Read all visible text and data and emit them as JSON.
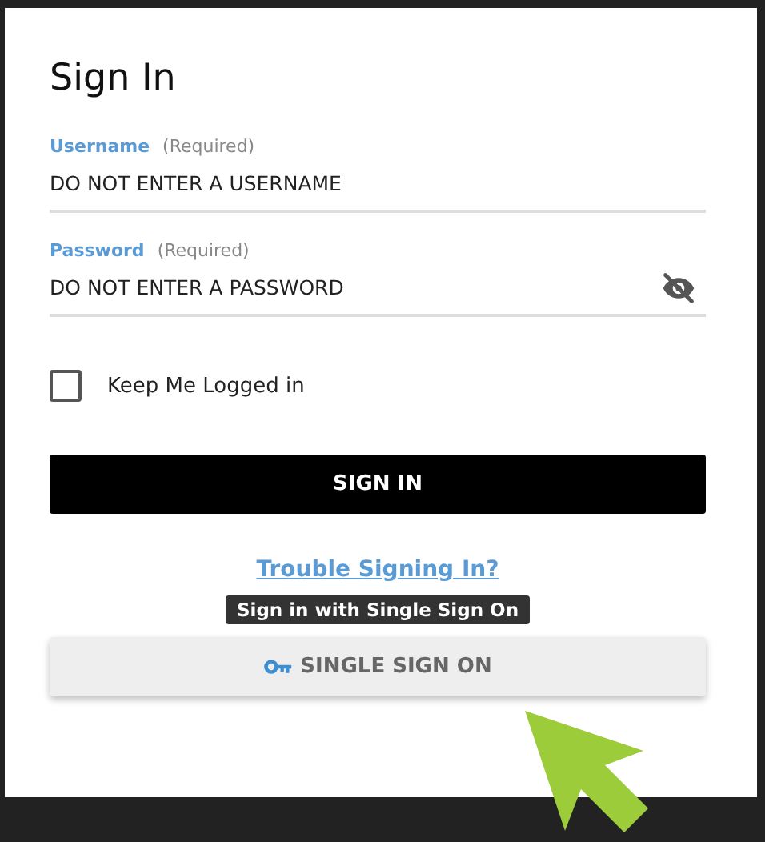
{
  "title": "Sign In",
  "username": {
    "label": "Username",
    "hint": "(Required)",
    "value": "DO NOT ENTER A USERNAME"
  },
  "password": {
    "label": "Password",
    "hint": "(Required)",
    "value": "DO NOT ENTER A PASSWORD",
    "visible": false
  },
  "keep_logged_in": {
    "label": "Keep Me Logged in",
    "checked": false
  },
  "sign_in_button": "SIGN IN",
  "trouble_link": "Trouble Signing In?",
  "tooltip": "Sign in with Single Sign On",
  "sso_button": "SINGLE SIGN ON"
}
